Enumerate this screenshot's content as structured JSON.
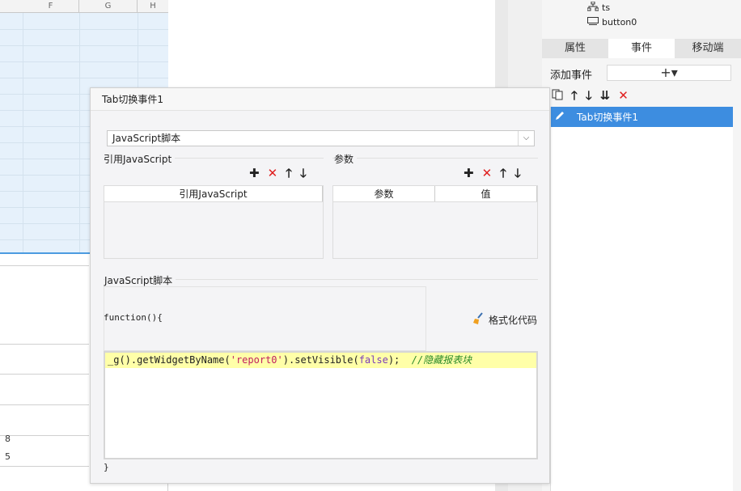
{
  "sheet": {
    "columns": [
      "F",
      "G",
      "H"
    ],
    "cell_values": [
      "8",
      "5"
    ]
  },
  "tree": {
    "items": [
      {
        "icon": "tree-node-icon",
        "label": "ts"
      },
      {
        "icon": "button-widget-icon",
        "label": "button0"
      }
    ]
  },
  "right_panel": {
    "tabs": [
      "属性",
      "事件",
      "移动端"
    ],
    "active_tab": "事件",
    "add_event_label": "添加事件",
    "add_event_symbol": "+▾",
    "events": [
      "Tab切换事件1"
    ]
  },
  "dialog": {
    "title": "Tab切换事件1",
    "type_select": "JavaScript脚本",
    "ref_js_section": "引用JavaScript",
    "ref_js_column": "引用JavaScript",
    "params_section": "参数",
    "params_columns": [
      "参数",
      "值"
    ],
    "script_section": "JavaScript脚本",
    "func_header": "function(){",
    "format_button": "格式化代码",
    "code": {
      "p1": "_g",
      "p2": "().getWidgetByName(",
      "p3": "'report0'",
      "p4": ").setVisible(",
      "p5": "false",
      "p6": ");  ",
      "comment": "//隐藏报表块"
    },
    "func_footer": "}"
  },
  "colors": {
    "accent": "#3d8de0",
    "delete_red": "#e02020",
    "code_highlight": "#ffffa8"
  }
}
